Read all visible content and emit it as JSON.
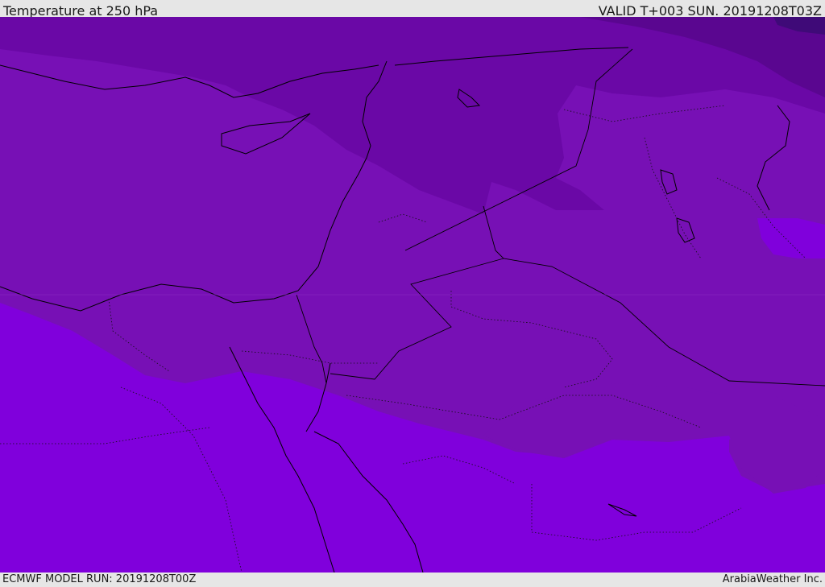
{
  "header": {
    "title": "Temperature at 250 hPa",
    "valid": "VALID T+003 SUN. 20191208T03Z"
  },
  "footer": {
    "model_run": "ECMWF MODEL RUN: 20191208T00Z",
    "credit": "ArabiaWeather Inc."
  },
  "map": {
    "variable": "temperature",
    "level": "250 hPa",
    "colors": {
      "coldest": "#3f0a78",
      "very_cold": "#5a0690",
      "cold": "#6a08a6",
      "mid": "#7710b5",
      "warm": "#8000dc",
      "border": "#000000"
    }
  }
}
